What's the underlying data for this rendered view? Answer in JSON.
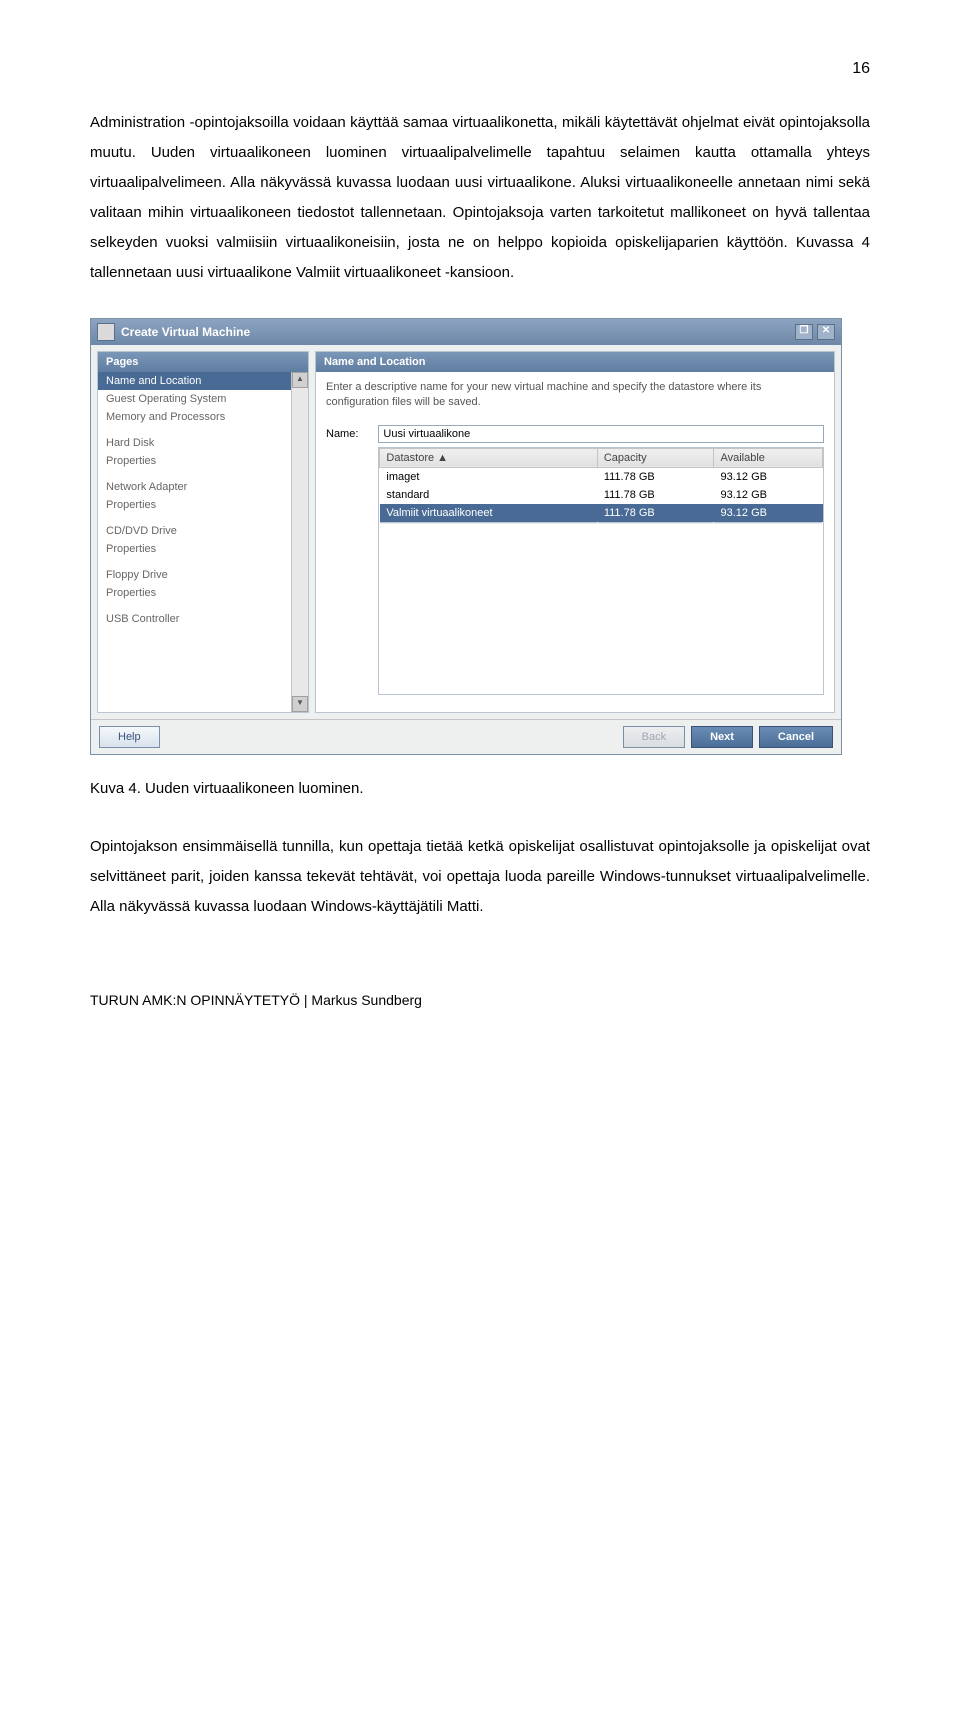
{
  "pageNumber": "16",
  "paragraph1": "Administration -opintojaksoilla voidaan käyttää samaa virtuaalikonetta, mikäli käytettävät ohjelmat eivät opintojaksolla muutu. Uuden virtuaalikoneen luominen virtuaalipalvelimelle tapahtuu selaimen kautta ottamalla yhteys virtuaalipalvelimeen. Alla näkyvässä kuvassa luodaan uusi virtuaalikone. Aluksi virtuaalikoneelle annetaan nimi sekä valitaan mihin virtuaalikoneen tiedostot tallennetaan. Opintojaksoja varten tarkoitetut mallikoneet on hyvä tallentaa selkeyden vuoksi valmiisiin virtuaalikoneisiin, josta ne on helppo kopioida opiskelijaparien käyttöön. Kuvassa 4 tallennetaan uusi virtuaalikone Valmiit virtuaalikoneet -kansioon.",
  "dialog": {
    "title": "Create Virtual Machine",
    "pagesHeader": "Pages",
    "pages": [
      "Name and Location",
      "Guest Operating System",
      "Memory and Processors",
      "",
      "Hard Disk",
      "Properties",
      "",
      "Network Adapter",
      "Properties",
      "",
      "CD/DVD Drive",
      "Properties",
      "",
      "Floppy Drive",
      "Properties",
      "",
      "USB Controller"
    ],
    "mainHeader": "Name and Location",
    "description": "Enter a descriptive name for your new virtual machine and specify the datastore where its configuration files will be saved.",
    "nameLabel": "Name:",
    "nameValue": "Uusi virtuaalikone",
    "columns": {
      "ds": "Datastore ▲",
      "cap": "Capacity",
      "avail": "Available"
    },
    "datastores": [
      {
        "name": "imaget",
        "capacity": "111.78 GB",
        "available": "93.12 GB",
        "selected": false
      },
      {
        "name": "standard",
        "capacity": "111.78 GB",
        "available": "93.12 GB",
        "selected": false
      },
      {
        "name": "Valmiit virtuaalikoneet",
        "capacity": "111.78 GB",
        "available": "93.12 GB",
        "selected": true
      }
    ],
    "help": "Help",
    "back": "Back",
    "next": "Next",
    "cancel": "Cancel"
  },
  "caption": "Kuva 4. Uuden virtuaalikoneen luominen.",
  "paragraph2": "Opintojakson ensimmäisellä tunnilla, kun opettaja tietää ketkä opiskelijat osallistuvat opintojaksolle ja opiskelijat ovat selvittäneet parit, joiden kanssa tekevät tehtävät, voi opettaja luoda pareille Windows-tunnukset virtuaalipalvelimelle. Alla näkyvässä kuvassa luodaan Windows-käyttäjätili Matti.",
  "footer": "TURUN AMK:N OPINNÄYTETYÖ | Markus Sundberg"
}
